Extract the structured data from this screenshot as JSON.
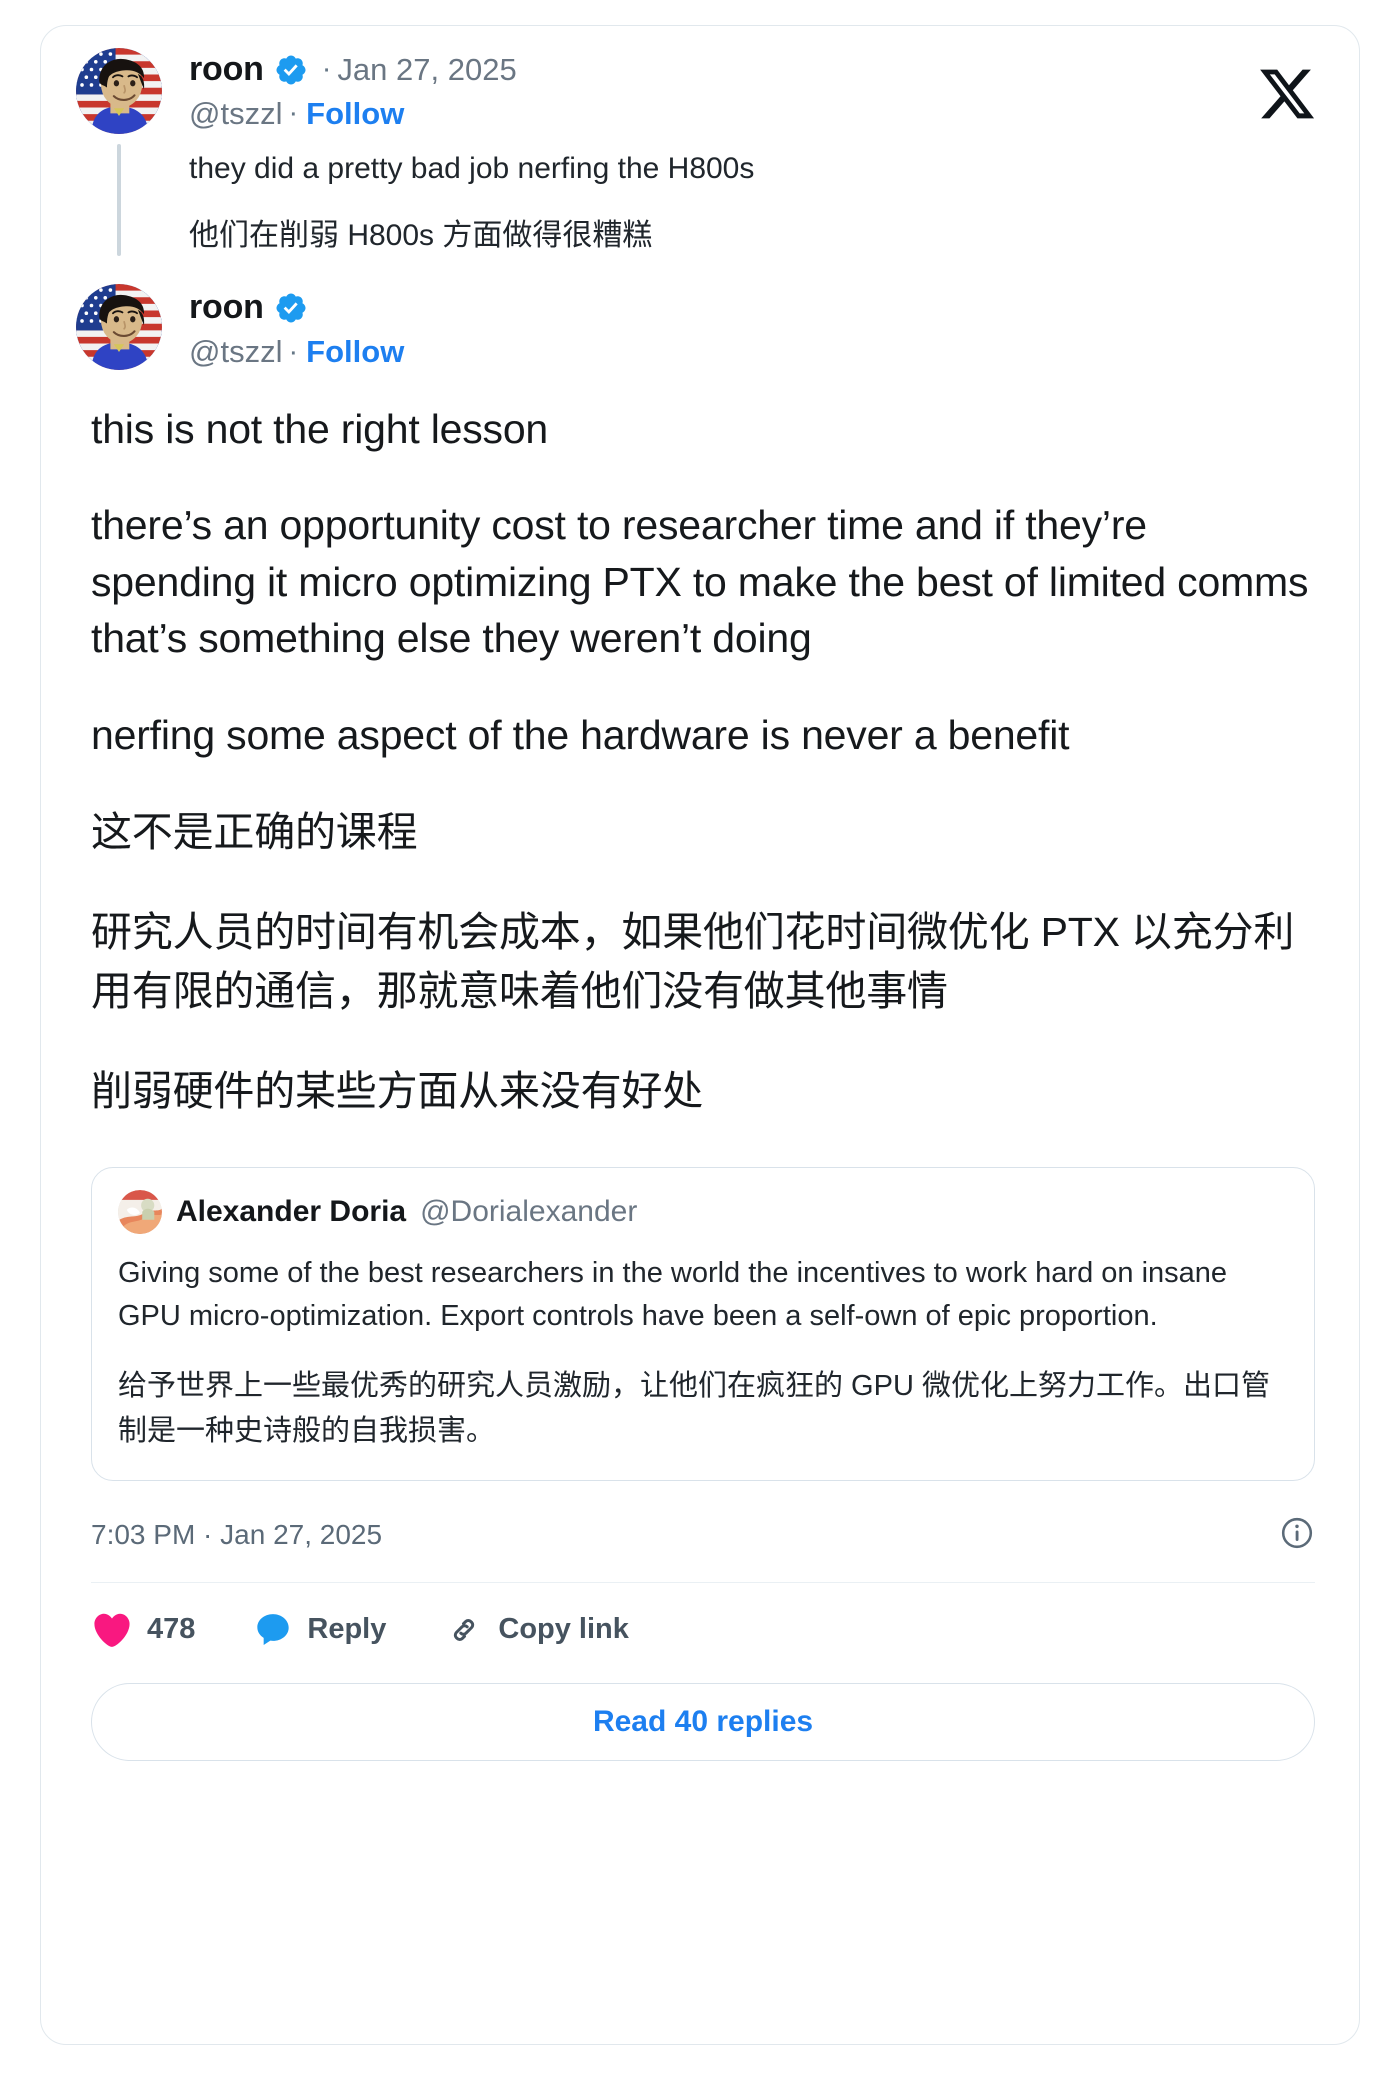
{
  "brand": {
    "logo_icon": "x-logo-icon",
    "accent_link": "#1d7ff0",
    "verified_blue": "#1d9bf0",
    "like_pink": "#f91880",
    "reply_blue": "#1d9bf0",
    "text_primary": "#16191c",
    "text_muted": "#6a7683",
    "border": "#e1e8ed"
  },
  "parent_tweet": {
    "avatar_icon": "avatar-roon-flag",
    "display_name": "roon",
    "verified_icon": "verified-badge-icon",
    "separator": "·",
    "date": "Jan 27, 2025",
    "handle": "@tszzl",
    "follow_label": "Follow",
    "text_en": "they did a pretty bad job nerfing the H800s",
    "text_zh": "他们在削弱 H800s 方面做得很糟糕"
  },
  "main_tweet": {
    "avatar_icon": "avatar-roon-flag",
    "display_name": "roon",
    "verified_icon": "verified-badge-icon",
    "handle": "@tszzl",
    "separator": "·",
    "follow_label": "Follow",
    "paragraphs": [
      "this is not the right lesson",
      "there’s an opportunity cost to researcher time and if they’re spending it micro optimizing PTX to make the best of limited comms that’s something else they weren’t doing",
      "nerfing some aspect of the hardware is never a benefit"
    ],
    "paragraphs_zh": [
      "这不是正确的课程",
      "研究人员的时间有机会成本，如果他们花时间微优化 PTX 以充分利用有限的通信，那就意味着他们没有做其他事情",
      "削弱硬件的某些方面从来没有好处"
    ]
  },
  "quoted_tweet": {
    "avatar_icon": "avatar-alexander-doria",
    "display_name": "Alexander Doria",
    "handle": "@Dorialexander",
    "text_en": "Giving some of the best researchers in the world the incentives to work hard on insane GPU micro-optimization. Export controls have been a self-own of epic proportion.",
    "text_zh": "给予世界上一些最优秀的研究人员激励，让他们在疯狂的 GPU 微优化上努力工作。出口管制是一种史诗般的自我损害。"
  },
  "meta": {
    "timestamp": "7:03 PM · Jan 27, 2025",
    "info_icon": "info-circle-icon"
  },
  "actions": {
    "like_icon": "heart-icon",
    "like_count": "478",
    "reply_icon": "comment-bubble-icon",
    "reply_label": "Reply",
    "copy_icon": "link-chain-icon",
    "copy_label": "Copy link"
  },
  "footer": {
    "read_replies_label": "Read 40 replies"
  }
}
